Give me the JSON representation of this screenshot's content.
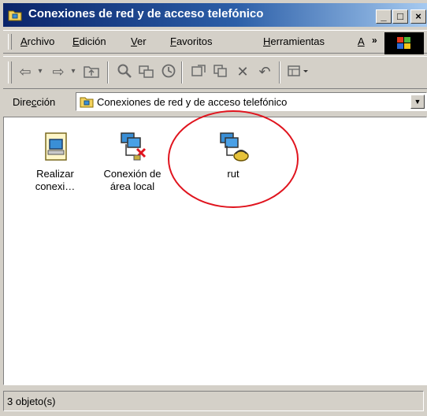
{
  "window": {
    "title": "Conexiones de red y de acceso telefónico",
    "minimize_label": "_",
    "maximize_label": "□",
    "close_label": "×"
  },
  "menu": {
    "items": [
      {
        "prefix": "",
        "mnemonic": "A",
        "rest": "rchivo"
      },
      {
        "prefix": "",
        "mnemonic": "E",
        "rest": "dición"
      },
      {
        "prefix": "",
        "mnemonic": "V",
        "rest": "er"
      },
      {
        "prefix": "",
        "mnemonic": "F",
        "rest": "avoritos"
      },
      {
        "prefix": "",
        "mnemonic": "H",
        "rest": "erramientas"
      },
      {
        "prefix": "",
        "mnemonic": "A",
        "rest": ""
      }
    ],
    "overflow": "»"
  },
  "toolbar": {
    "icons": [
      "back-arrow-icon",
      "dropdown-icon",
      "forward-arrow-icon",
      "dropdown-icon",
      "up-folder-icon",
      "search-icon",
      "folders-icon",
      "history-icon",
      "move-to-icon",
      "copy-to-icon",
      "delete-icon",
      "undo-icon",
      "views-icon"
    ]
  },
  "address": {
    "label_prefix": "Dire",
    "label_mnemonic": "c",
    "label_rest": "ción",
    "value": "Conexiones de red y de acceso telefónico"
  },
  "items": [
    {
      "line1": "Realizar",
      "line2": "conexi…",
      "icon": "new-connection-icon"
    },
    {
      "line1": "Conexión de",
      "line2": "área local",
      "icon": "lan-connection-disconnected-icon"
    },
    {
      "line1": "rut",
      "line2": "",
      "icon": "dialup-connection-icon"
    }
  ],
  "status": {
    "text": "3 objeto(s)"
  },
  "colors": {
    "title_start": "#0a246a",
    "title_end": "#a6caf0",
    "highlight_circle": "#e0141e"
  }
}
